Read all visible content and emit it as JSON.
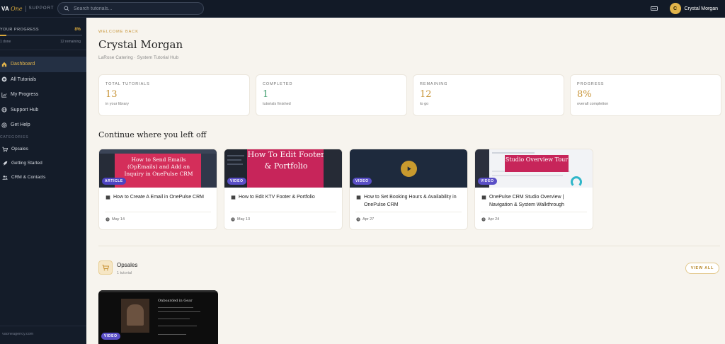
{
  "topbar": {
    "logo_va": "VA",
    "logo_one": "One",
    "logo_support": "SUPPORT",
    "search_placeholder": "Search tutorials...",
    "user_initial": "C",
    "user_name": "Crystal Morgan"
  },
  "sidebar": {
    "progress_title": "YOUR PROGRESS",
    "progress_pct": "8%",
    "progress_fraction": 0.08,
    "progress_done": "1 done",
    "progress_remaining": "12 remaining",
    "nav": [
      {
        "label": "Dashboard",
        "icon": "home-icon",
        "active": true
      },
      {
        "label": "All Tutorials",
        "icon": "plus-circle-icon"
      },
      {
        "label": "My Progress",
        "icon": "chart-icon"
      },
      {
        "label": "Support Hub",
        "icon": "globe-icon"
      },
      {
        "label": "Get Help",
        "icon": "help-icon"
      }
    ],
    "categories_title": "CATEGORIES",
    "categories": [
      {
        "label": "Opsales",
        "icon": "cart-icon"
      },
      {
        "label": "Getting Started",
        "icon": "rocket-icon"
      },
      {
        "label": "CRM & Contacts",
        "icon": "users-icon"
      }
    ],
    "footer": "vaoneagency.com"
  },
  "main": {
    "welcome": "WELCOME BACK",
    "name": "Crystal Morgan",
    "subtitle": "LaRose Catering · System Tutorial Hub",
    "stats": [
      {
        "label": "TOTAL TUTORIALS",
        "value": "13",
        "sub": "in your library",
        "color": "#c9963a"
      },
      {
        "label": "COMPLETED",
        "value": "1",
        "sub": "tutorials finished",
        "color": "#3e9c6c"
      },
      {
        "label": "REMAINING",
        "value": "12",
        "sub": "to go",
        "color": "#c9963a"
      },
      {
        "label": "PROGRESS",
        "value": "8%",
        "sub": "overall completion",
        "color": "#c9963a"
      }
    ],
    "continue_heading": "Continue where you left off",
    "cards": [
      {
        "badge": "ARTICLE",
        "title": "How to Create A Email in OnePulse CRM",
        "date": "May 14",
        "thumb_text": "How to Send Emails (OpEmails) and Add an Inquiry in OnePulse CRM"
      },
      {
        "badge": "VIDEO",
        "title": "How to Edit KTV Footer & Portfolio",
        "date": "May 13",
        "thumb_text": "How To Edit Footer & Portfolio"
      },
      {
        "badge": "VIDEO",
        "title": "How to Set Booking Hours & Availability in OnePulse CRM",
        "date": "Apr 27",
        "thumb_text": ""
      },
      {
        "badge": "VIDEO",
        "title": "OnePulse CRM Studio Overview | Navigation & System Walkthrough",
        "date": "Apr 24",
        "thumb_text": "Studio Overview Tour"
      }
    ],
    "category_section": {
      "name": "Opsales",
      "count": "1 tutorial",
      "view_all": "VIEW ALL",
      "card_badge": "VIDEO",
      "card_thumb_text": "Onboarded in Gear"
    }
  }
}
